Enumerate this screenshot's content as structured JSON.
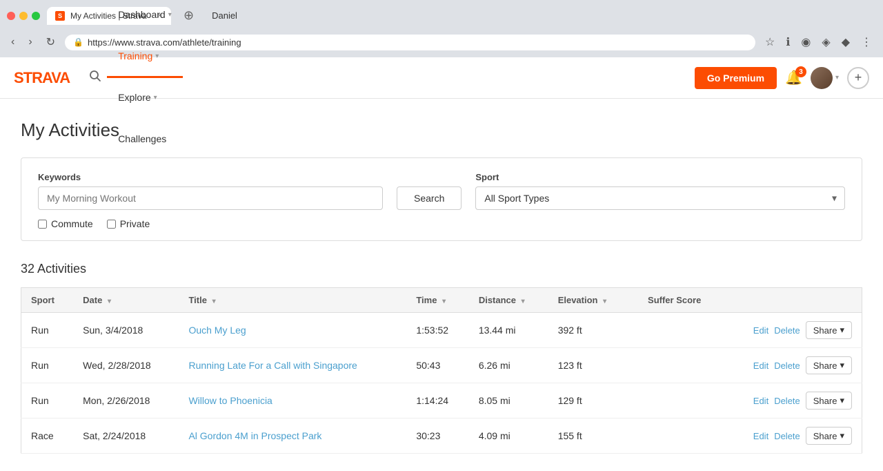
{
  "browser": {
    "user": "Daniel",
    "tab": {
      "title": "My Activities | Strava",
      "favicon": "S",
      "url": "https://www.strava.com/athlete/training",
      "secure_label": "Secure"
    }
  },
  "nav": {
    "logo": "STRAVA",
    "items": [
      {
        "label": "Dashboard",
        "dropdown": true,
        "active": false
      },
      {
        "label": "Training",
        "dropdown": true,
        "active": true
      },
      {
        "label": "Explore",
        "dropdown": true,
        "active": false
      },
      {
        "label": "Challenges",
        "dropdown": false,
        "active": false
      }
    ],
    "go_premium_label": "Go Premium",
    "notification_count": "3"
  },
  "page": {
    "title": "My Activities"
  },
  "filter": {
    "keywords_label": "Keywords",
    "keywords_placeholder": "My Morning Workout",
    "search_button": "Search",
    "sport_label": "Sport",
    "sport_default": "All Sport Types",
    "commute_label": "Commute",
    "private_label": "Private"
  },
  "activities": {
    "count_label": "32 Activities",
    "columns": {
      "sport": "Sport",
      "date": "Date",
      "title": "Title",
      "time": "Time",
      "distance": "Distance",
      "elevation": "Elevation",
      "suffer_score": "Suffer Score"
    },
    "rows": [
      {
        "sport": "Run",
        "date": "Sun, 3/4/2018",
        "title": "Ouch My Leg",
        "time": "1:53:52",
        "distance": "13.44 mi",
        "elevation": "392 ft",
        "suffer_score": ""
      },
      {
        "sport": "Run",
        "date": "Wed, 2/28/2018",
        "title": "Running Late For a Call with Singapore",
        "time": "50:43",
        "distance": "6.26 mi",
        "elevation": "123 ft",
        "suffer_score": ""
      },
      {
        "sport": "Run",
        "date": "Mon, 2/26/2018",
        "title": "Willow to Phoenicia",
        "time": "1:14:24",
        "distance": "8.05 mi",
        "elevation": "129 ft",
        "suffer_score": ""
      },
      {
        "sport": "Race",
        "date": "Sat, 2/24/2018",
        "title": "Al Gordon 4M in Prospect Park",
        "time": "30:23",
        "distance": "4.09 mi",
        "elevation": "155 ft",
        "suffer_score": ""
      }
    ],
    "edit_label": "Edit",
    "delete_label": "Delete",
    "share_label": "Share"
  }
}
